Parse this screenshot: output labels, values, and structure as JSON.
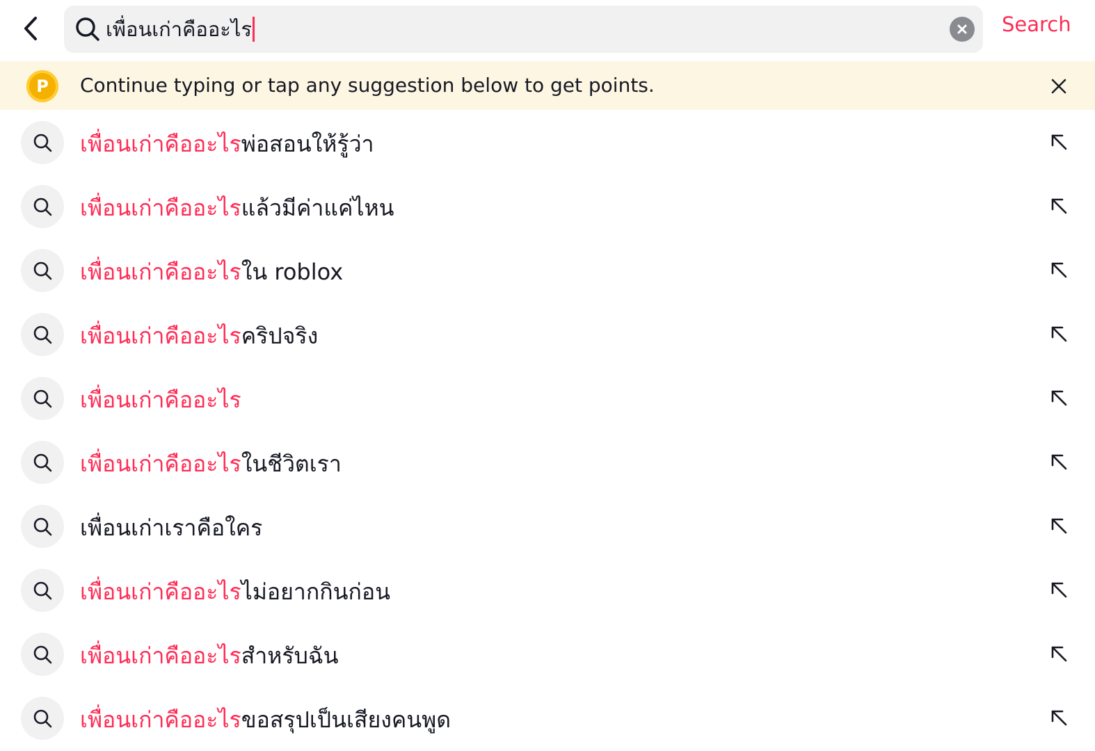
{
  "header": {
    "back_icon": "chevron-left-icon",
    "search_icon": "search-icon",
    "query": "เพื่อนเก่าคืออะไร",
    "clear_icon": "clear-circle-icon",
    "search_button": "Search",
    "accent_color": "#fe2c55"
  },
  "banner": {
    "coin_label": "P",
    "text": "Continue typing or tap any suggestion below to get points.",
    "close_icon": "close-icon"
  },
  "suggestions": [
    {
      "highlight": "เพื่อนเก่าคืออะไร",
      "rest": "พ่อสอนให้รู้ว่า"
    },
    {
      "highlight": "เพื่อนเก่าคืออะไร",
      "rest": "แล้วมีค่าแค่ไหน"
    },
    {
      "highlight": "เพื่อนเก่าคืออะไร",
      "rest": "ใน roblox"
    },
    {
      "highlight": "เพื่อนเก่าคืออะไร",
      "rest": "คริปจริง"
    },
    {
      "highlight": "เพื่อนเก่าคืออะไร",
      "rest": ""
    },
    {
      "highlight": "เพื่อนเก่าคืออะไร",
      "rest": "ในชีวิตเรา"
    },
    {
      "highlight": "",
      "rest": "เพื่อนเก่าเราคือใคร"
    },
    {
      "highlight": "เพื่อนเก่าคืออะไร",
      "rest": "ไม่อยากกินก่อน"
    },
    {
      "highlight": "เพื่อนเก่าคืออะไร",
      "rest": "สำหรับฉัน"
    },
    {
      "highlight": "เพื่อนเก่าคืออะไร",
      "rest": "ขอสรุปเป็นเสียงคนพูด"
    }
  ]
}
